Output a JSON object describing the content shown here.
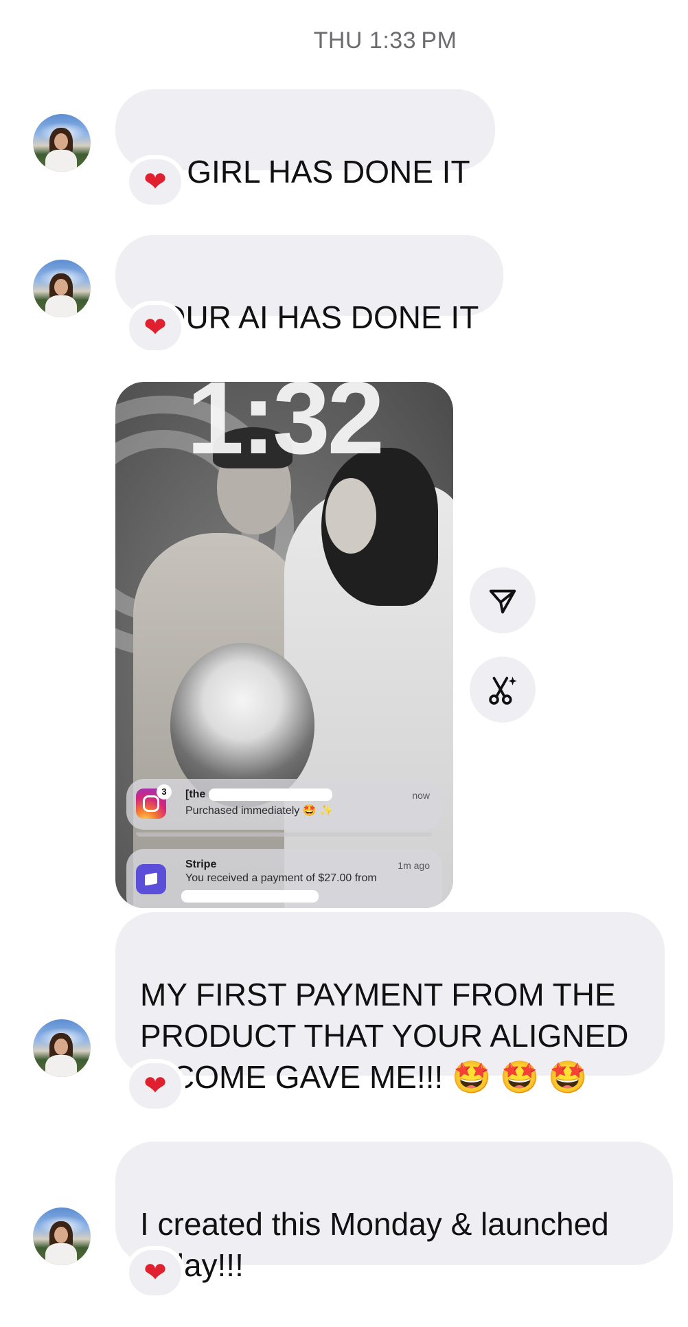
{
  "timestamp": "THU 1:33 PM",
  "messages": [
    {
      "text": "YA GIRL HAS DONE IT",
      "reaction": "❤"
    },
    {
      "text": "YOUR AI HAS DONE IT",
      "reaction": "❤"
    },
    {
      "text": "MY FIRST PAYMENT FROM THE\nPRODUCT THAT YOUR ALIGNED\nINCOME GAVE ME!!! 🤩 🤩 🤩",
      "reaction": "❤"
    },
    {
      "text": "I created this Monday & launched\ntoday!!!",
      "reaction": "❤"
    }
  ],
  "screenshot": {
    "clock": "1:32",
    "notifications": [
      {
        "app": "instagram",
        "icon": "instagram-icon",
        "badge": "3",
        "title": "[the",
        "text": "Purchased immediately 🤩 ✨",
        "time": "now"
      },
      {
        "app": "stripe",
        "icon": "stripe-icon",
        "title": "Stripe",
        "text": "You received a payment of $27.00 from",
        "time": "1m ago"
      }
    ]
  },
  "actions": [
    {
      "name": "share",
      "icon": "send-icon"
    },
    {
      "name": "remix",
      "icon": "scissors-sparkle-icon"
    }
  ],
  "colors": {
    "bubble": "#efeff3",
    "heart": "#e0202e",
    "timestamp": "#6b6b70",
    "stripe": "#5b4fd9"
  }
}
